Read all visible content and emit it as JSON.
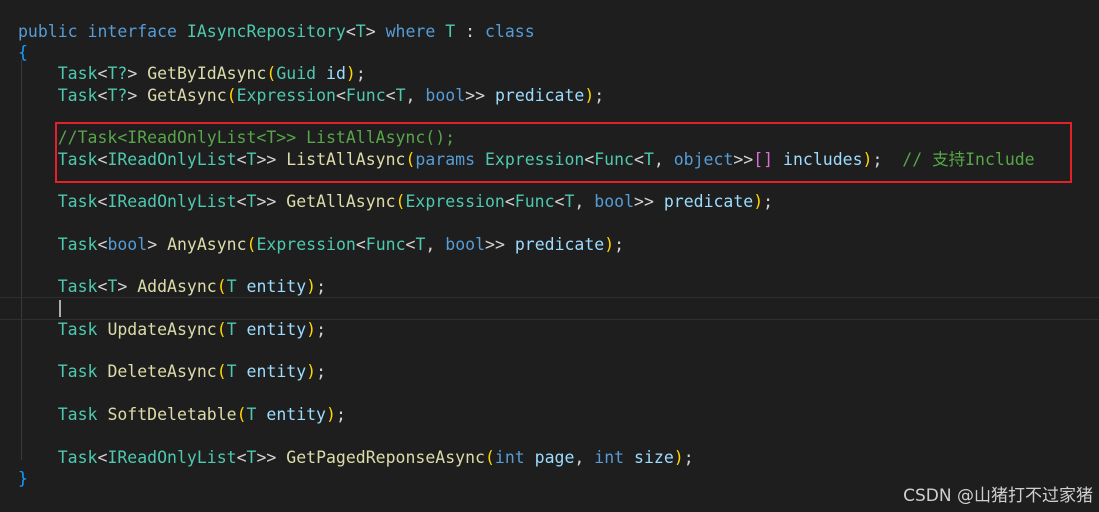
{
  "code": {
    "line_declaration": {
      "kw_public": "public",
      "kw_interface": "interface",
      "name": "IAsyncRepository",
      "lt": "<",
      "type_param": "T",
      "gt": ">",
      "kw_where": "where",
      "constraint_param": "T",
      "colon": ":",
      "kw_class": "class"
    },
    "open_brace": "{",
    "close_brace": "}",
    "line_get_by_id": {
      "task": "Task",
      "lt": "<",
      "ret": "T?",
      "gt": ">",
      "method": "GetByIdAsync",
      "paren_open": "(",
      "param_type": "Guid",
      "param_name": "id",
      "paren_close": ")",
      "semicolon": ";"
    },
    "line_get": {
      "task": "Task",
      "lt": "<",
      "ret": "T?",
      "gt": ">",
      "method": "GetAsync",
      "paren_open": "(",
      "expr": "Expression",
      "lt2": "<",
      "func": "Func",
      "lt3": "<",
      "t": "T",
      "comma": ",",
      "bool": "bool",
      "gt2": ">>",
      "param_name": "predicate",
      "paren_close": ")",
      "semicolon": ";"
    },
    "line_comment": "//Task<IReadOnlyList<T>> ListAllAsync();",
    "line_list_all": {
      "task": "Task",
      "lt": "<",
      "list": "IReadOnlyList",
      "lt2": "<",
      "t": "T",
      "gt2": ">>",
      "method": "ListAllAsync",
      "paren_open": "(",
      "kw_params": "params",
      "expr": "Expression",
      "lt3": "<",
      "func": "Func",
      "lt4": "<",
      "t2": "T",
      "comma": ",",
      "obj": "object",
      "gt3": ">>",
      "brackets": "[]",
      "param_name": "includes",
      "paren_close": ")",
      "semicolon": ";",
      "trailing_comment": "// 支持Include"
    },
    "line_get_all": {
      "task": "Task",
      "lt": "<",
      "list": "IReadOnlyList",
      "lt2": "<",
      "t": "T",
      "gt2": ">>",
      "method": "GetAllAsync",
      "paren_open": "(",
      "expr": "Expression",
      "lt3": "<",
      "func": "Func",
      "lt4": "<",
      "t2": "T",
      "comma": ",",
      "bool": "bool",
      "gt3": ">>",
      "param_name": "predicate",
      "paren_close": ")",
      "semicolon": ";"
    },
    "line_any": {
      "task": "Task",
      "lt": "<",
      "bool_ret": "bool",
      "gt": ">",
      "method": "AnyAsync",
      "paren_open": "(",
      "expr": "Expression",
      "lt2": "<",
      "func": "Func",
      "lt3": "<",
      "t": "T",
      "comma": ",",
      "bool": "bool",
      "gt2": ">>",
      "param_name": "predicate",
      "paren_close": ")",
      "semicolon": ";"
    },
    "line_add": {
      "task": "Task",
      "lt": "<",
      "t": "T",
      "gt": ">",
      "method": "AddAsync",
      "paren_open": "(",
      "param_type": "T",
      "param_name": "entity",
      "paren_close": ")",
      "semicolon": ";"
    },
    "line_update": {
      "task": "Task",
      "method": "UpdateAsync",
      "paren_open": "(",
      "param_type": "T",
      "param_name": "entity",
      "paren_close": ")",
      "semicolon": ";"
    },
    "line_delete": {
      "task": "Task",
      "method": "DeleteAsync",
      "paren_open": "(",
      "param_type": "T",
      "param_name": "entity",
      "paren_close": ")",
      "semicolon": ";"
    },
    "line_soft_delete": {
      "task": "Task",
      "method": "SoftDeletable",
      "paren_open": "(",
      "param_type": "T",
      "param_name": "entity",
      "paren_close": ")",
      "semicolon": ";"
    },
    "line_paged": {
      "task": "Task",
      "lt": "<",
      "list": "IReadOnlyList",
      "lt2": "<",
      "t": "T",
      "gt2": ">>",
      "method": "GetPagedReponseAsync",
      "paren_open": "(",
      "int1": "int",
      "param1": "page",
      "comma": ",",
      "int2": "int",
      "param2": "size",
      "paren_close": ")",
      "semicolon": ";"
    }
  },
  "watermark": "CSDN @山猪打不过家猪",
  "colors": {
    "background": "#1e1e1e",
    "keyword": "#569cd6",
    "type": "#4ec9b0",
    "method": "#dcdcaa",
    "parameter": "#9cdcfe",
    "comment": "#57a64a",
    "highlight_border": "#e4212b"
  }
}
